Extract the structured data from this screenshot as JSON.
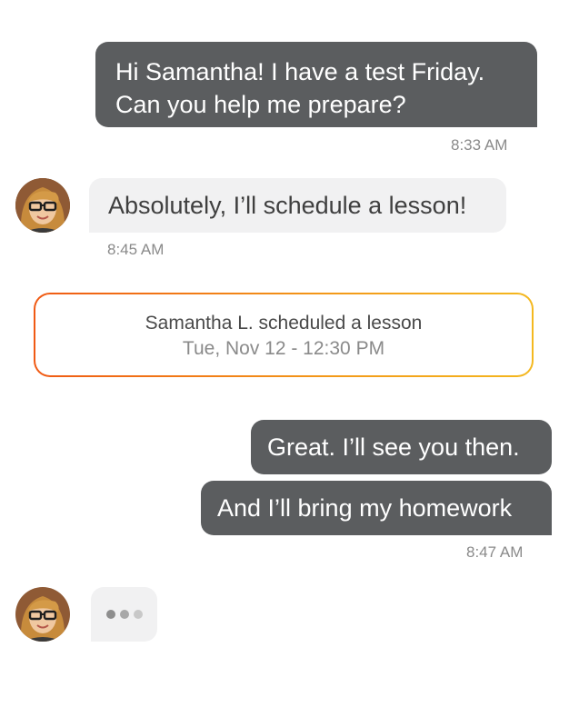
{
  "messages": [
    {
      "id": "m1",
      "direction": "outgoing",
      "lines": [
        "Hi Samantha! I have a test Friday.",
        "Can you help me prepare?"
      ],
      "time": "8:33 AM"
    },
    {
      "id": "m2",
      "direction": "incoming",
      "text": "Absolutely, I’ll schedule a lesson!",
      "time": "8:45 AM"
    },
    {
      "id": "m3",
      "direction": "outgoing",
      "text": "Great. I’ll see you then."
    },
    {
      "id": "m4",
      "direction": "outgoing",
      "text": "And I’ll bring my homework",
      "time": "8:47 AM"
    }
  ],
  "event": {
    "title": "Samantha L. scheduled a lesson",
    "datetime": "Tue, Nov 12 - 12:30 PM"
  },
  "colors": {
    "outgoing_bubble": "#5b5d5f",
    "incoming_bubble": "#f1f1f2",
    "event_border_start": "#f05a14",
    "event_border_end": "#f4b81f",
    "timestamp": "#8a8a8a"
  },
  "icons": {
    "avatar": "samantha-avatar"
  },
  "typing_indicator": {
    "state": "typing"
  }
}
